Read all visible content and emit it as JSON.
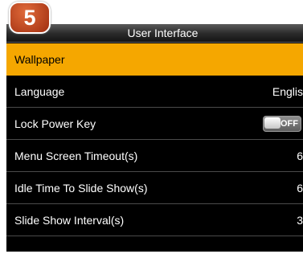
{
  "badge": {
    "number": "5"
  },
  "header": {
    "title": "User Interface"
  },
  "menu": {
    "items": [
      {
        "label": "Wallpaper",
        "value": ""
      },
      {
        "label": "Language",
        "value": "Englis"
      },
      {
        "label": "Lock Power Key",
        "value": "OFF"
      },
      {
        "label": "Menu Screen Timeout(s)",
        "value": "6"
      },
      {
        "label": "Idle Time To Slide Show(s)",
        "value": "6"
      },
      {
        "label": "Slide Show Interval(s)",
        "value": "3"
      }
    ],
    "selected_index": 0,
    "lock_power_key_state": "off"
  },
  "colors": {
    "highlight": "#f5a700",
    "screen_background": "#000000",
    "badge": "#c0441f"
  }
}
